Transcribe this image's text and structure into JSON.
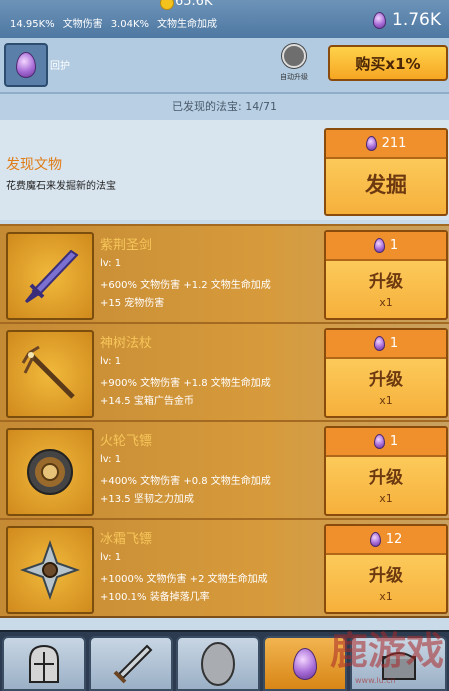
{
  "topbar": {
    "coins": "65.6K",
    "stats": [
      {
        "value": "14.95K%",
        "label": "文物伤害"
      },
      {
        "value": "3.04K%",
        "label": "文物生命加成"
      }
    ],
    "gem_total": "1.76K"
  },
  "subbar": {
    "heal_label": "回护",
    "auto_upgrade_label": "自动升级",
    "buy_button": "购买x1%"
  },
  "found_label": "已发现的法宝: 14/71",
  "discover": {
    "title": "发现文物",
    "desc": "花费魔石来发掘新的法宝",
    "cost": "211",
    "button": "发掘"
  },
  "items": [
    {
      "name": "紫荆圣剑",
      "lv": "lv: 1",
      "s1": "+600% 文物伤害 +1.2 文物生命加成",
      "s2": "+15 宠物伤害",
      "cost": "1",
      "button": "升级",
      "mult": "x1"
    },
    {
      "name": "神树法杖",
      "lv": "lv: 1",
      "s1": "+900% 文物伤害 +1.8 文物生命加成",
      "s2": "+14.5 宝箱广告金币",
      "cost": "1",
      "button": "升级",
      "mult": "x1"
    },
    {
      "name": "火轮飞镖",
      "lv": "lv: 1",
      "s1": "+400% 文物伤害 +0.8 文物生命加成",
      "s2": "+13.5 坚韧之力加成",
      "cost": "1",
      "button": "升级",
      "mult": "x1"
    },
    {
      "name": "冰霜飞镖",
      "lv": "lv: 1",
      "s1": "+1000% 文物伤害 +2 文物生命加成",
      "s2": "+100.1% 装备掉落几率",
      "cost": "12",
      "button": "升级",
      "mult": "x1"
    }
  ],
  "watermark": {
    "text": "鹿游戏",
    "url": "www.lu.cn"
  },
  "colors": {
    "accent": "#f6a623",
    "title": "#e07d16",
    "item_name": "#f7c65a"
  }
}
